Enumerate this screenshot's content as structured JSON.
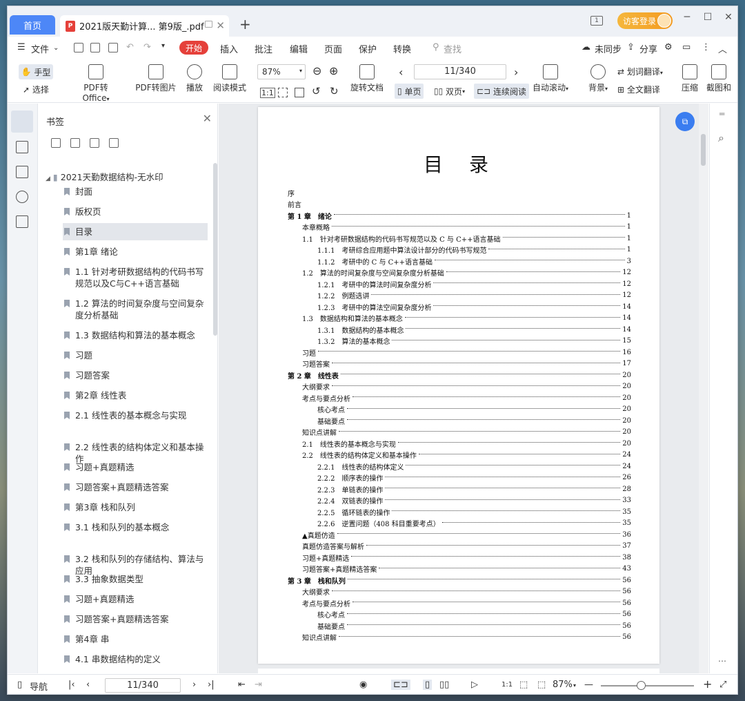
{
  "tabs": {
    "home": "首页",
    "doc_title": "2021版天勤计算... 第9版_.pdf",
    "pdf_badge": "P"
  },
  "window": {
    "visitor_login": "访客登录",
    "count_badge": "1"
  },
  "menu": {
    "file": "文件",
    "start": "开始",
    "items": [
      "插入",
      "批注",
      "编辑",
      "页面",
      "保护",
      "转换"
    ],
    "search": "查找",
    "unsynced": "未同步",
    "share": "分享"
  },
  "ribbon": {
    "hand": "手型",
    "select": "选择",
    "pdf_to_office": "PDF转Office",
    "pdf_to_image": "PDF转图片",
    "play": "播放",
    "read_mode": "阅读模式",
    "zoom": "87%",
    "page": "11/340",
    "rotate_doc": "旋转文档",
    "single_page": "单页",
    "double_page": "双页",
    "continuous": "连续阅读",
    "auto_scroll": "自动滚动",
    "background": "背景",
    "word_translate": "划词翻译",
    "full_translate": "全文翻译",
    "compress": "压缩",
    "screenshot": "截图和"
  },
  "panel": {
    "title": "书签",
    "root": "2021天勤数据结构-无水印",
    "items": [
      "封面",
      "版权页",
      "目录",
      "第1章 绪论",
      "1.1 针对考研数据结构的代码书写规范以及C与C++语言基础",
      "1.2 算法的时间复杂度与空间复杂度分析基础",
      "1.3 数据结构和算法的基本概念",
      "习题",
      "习题答案",
      "第2章 线性表",
      "2.1 线性表的基本概念与实现",
      "2.2 线性表的结构体定义和基本操作",
      "习题+真题精选",
      "习题答案+真题精选答案",
      "第3章 栈和队列",
      "3.1 栈和队列的基本概念",
      "3.2 栈和队列的存储结构、算法与应用",
      "3.3 抽象数据类型",
      "习题+真题精选",
      "习题答案+真题精选答案",
      "第4章 串",
      "4.1 串数据结构的定义"
    ],
    "selected_index": 2
  },
  "document": {
    "heading": "目录",
    "toc": [
      {
        "text": "序",
        "page": "",
        "level": 0
      },
      {
        "text": "前言",
        "page": "",
        "level": 0
      },
      {
        "text": "第 1 章　绪论",
        "page": "1",
        "level": 0,
        "chapter": true
      },
      {
        "text": "本章概略",
        "page": "1",
        "level": 1
      },
      {
        "text": "1.1　针对考研数据结构的代码书写规范以及 C 与 C++语言基础",
        "page": "1",
        "level": 1
      },
      {
        "text": "1.1.1　考研综合应用题中算法设计部分的代码书写规范",
        "page": "1",
        "level": 2
      },
      {
        "text": "1.1.2　考研中的 C 与 C++语言基础",
        "page": "3",
        "level": 2
      },
      {
        "text": "1.2　算法的时间复杂度与空间复杂度分析基础",
        "page": "12",
        "level": 1
      },
      {
        "text": "1.2.1　考研中的算法时间复杂度分析",
        "page": "12",
        "level": 2
      },
      {
        "text": "1.2.2　例题选讲",
        "page": "12",
        "level": 2
      },
      {
        "text": "1.2.3　考研中的算法空间复杂度分析",
        "page": "14",
        "level": 2
      },
      {
        "text": "1.3　数据结构和算法的基本概念",
        "page": "14",
        "level": 1
      },
      {
        "text": "1.3.1　数据结构的基本概念",
        "page": "14",
        "level": 2
      },
      {
        "text": "1.3.2　算法的基本概念",
        "page": "15",
        "level": 2
      },
      {
        "text": "习题",
        "page": "16",
        "level": 1
      },
      {
        "text": "习题答案",
        "page": "17",
        "level": 1
      },
      {
        "text": "第 2 章　线性表",
        "page": "20",
        "level": 0,
        "chapter": true
      },
      {
        "text": "大纲要求",
        "page": "20",
        "level": 1
      },
      {
        "text": "考点与要点分析",
        "page": "20",
        "level": 1
      },
      {
        "text": "核心考点",
        "page": "20",
        "level": 2
      },
      {
        "text": "基础要点",
        "page": "20",
        "level": 2
      },
      {
        "text": "知识点讲解",
        "page": "20",
        "level": 1
      },
      {
        "text": "2.1　线性表的基本概念与实现",
        "page": "20",
        "level": 1
      },
      {
        "text": "2.2　线性表的结构体定义和基本操作",
        "page": "24",
        "level": 1
      },
      {
        "text": "2.2.1　线性表的结构体定义",
        "page": "24",
        "level": 2
      },
      {
        "text": "2.2.2　顺序表的操作",
        "page": "26",
        "level": 2
      },
      {
        "text": "2.2.3　单链表的操作",
        "page": "28",
        "level": 2
      },
      {
        "text": "2.2.4　双链表的操作",
        "page": "33",
        "level": 2
      },
      {
        "text": "2.2.5　循环链表的操作",
        "page": "35",
        "level": 2
      },
      {
        "text": "2.2.6　逆置问题（408 科目重要考点）",
        "page": "35",
        "level": 2
      },
      {
        "text": "▲真题仿造",
        "page": "36",
        "level": 1
      },
      {
        "text": "真题仿造答案与解析",
        "page": "37",
        "level": 1
      },
      {
        "text": "习题+真题精选",
        "page": "38",
        "level": 1
      },
      {
        "text": "习题答案+真题精选答案",
        "page": "43",
        "level": 1
      },
      {
        "text": "第 3 章　栈和队列",
        "page": "56",
        "level": 0,
        "chapter": true
      },
      {
        "text": "大纲要求",
        "page": "56",
        "level": 1
      },
      {
        "text": "考点与要点分析",
        "page": "56",
        "level": 1
      },
      {
        "text": "核心考点",
        "page": "56",
        "level": 2
      },
      {
        "text": "基础要点",
        "page": "56",
        "level": 2
      },
      {
        "text": "知识点讲解",
        "page": "56",
        "level": 1
      }
    ]
  },
  "status": {
    "nav": "导航",
    "page": "11/340",
    "zoom": "87%"
  },
  "colors": {
    "accent": "#4d87f7",
    "start_red": "#e5403a",
    "visitor": "#f39a1f",
    "fab": "#3a7df0"
  }
}
